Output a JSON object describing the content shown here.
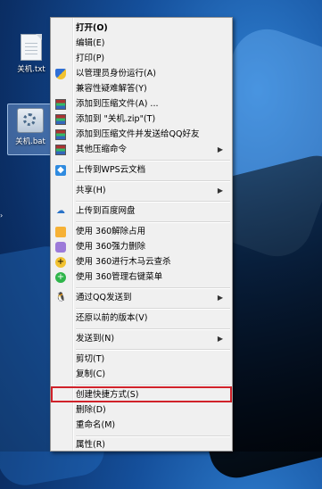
{
  "desktop": {
    "icons": [
      {
        "label": "关机.txt",
        "icon": "text-file-icon"
      },
      {
        "label": "关机.bat",
        "icon": "batch-file-icon"
      }
    ]
  },
  "context_menu": {
    "items": [
      {
        "label": "打开(O)",
        "bold": true,
        "icon": null,
        "submenu": false
      },
      {
        "label": "编辑(E)",
        "icon": null,
        "submenu": false
      },
      {
        "label": "打印(P)",
        "icon": null,
        "submenu": false
      },
      {
        "label": "以管理员身份运行(A)",
        "icon": "uac-shield-icon",
        "submenu": false
      },
      {
        "label": "兼容性疑难解答(Y)",
        "icon": null,
        "submenu": false
      },
      {
        "label": "添加到压缩文件(A) ...",
        "icon": "winrar-icon",
        "submenu": false
      },
      {
        "label": "添加到 \"关机.zip\"(T)",
        "icon": "winrar-icon",
        "submenu": false
      },
      {
        "label": "添加到压缩文件并发送给QQ好友",
        "icon": "winrar-icon",
        "submenu": false
      },
      {
        "label": "其他压缩命令",
        "icon": "winrar-icon",
        "submenu": true
      },
      {
        "label": "上传到WPS云文档",
        "icon": "wps-cloud-icon",
        "submenu": false
      },
      {
        "label": "共享(H)",
        "icon": null,
        "submenu": true
      },
      {
        "label": "上传到百度网盘",
        "icon": "baidu-cloud-icon",
        "submenu": false
      },
      {
        "label": "使用 360解除占用",
        "icon": "360-unlock-icon",
        "submenu": false
      },
      {
        "label": "使用 360强力删除",
        "icon": "360-delete-icon",
        "submenu": false
      },
      {
        "label": "使用 360进行木马云查杀",
        "icon": "360-scan-icon",
        "submenu": false
      },
      {
        "label": "使用 360管理右键菜单",
        "icon": "360-menu-icon",
        "submenu": false
      },
      {
        "label": "通过QQ发送到",
        "icon": "qq-penguin-icon",
        "submenu": true
      },
      {
        "label": "还原以前的版本(V)",
        "icon": null,
        "submenu": false
      },
      {
        "label": "发送到(N)",
        "icon": null,
        "submenu": true
      },
      {
        "label": "剪切(T)",
        "icon": null,
        "submenu": false
      },
      {
        "label": "复制(C)",
        "icon": null,
        "submenu": false
      },
      {
        "label": "创建快捷方式(S)",
        "icon": null,
        "submenu": false,
        "highlighted": true
      },
      {
        "label": "删除(D)",
        "icon": null,
        "submenu": false
      },
      {
        "label": "重命名(M)",
        "icon": null,
        "submenu": false
      },
      {
        "label": "属性(R)",
        "icon": null,
        "submenu": false
      }
    ],
    "highlight_color": "#d0222a"
  }
}
